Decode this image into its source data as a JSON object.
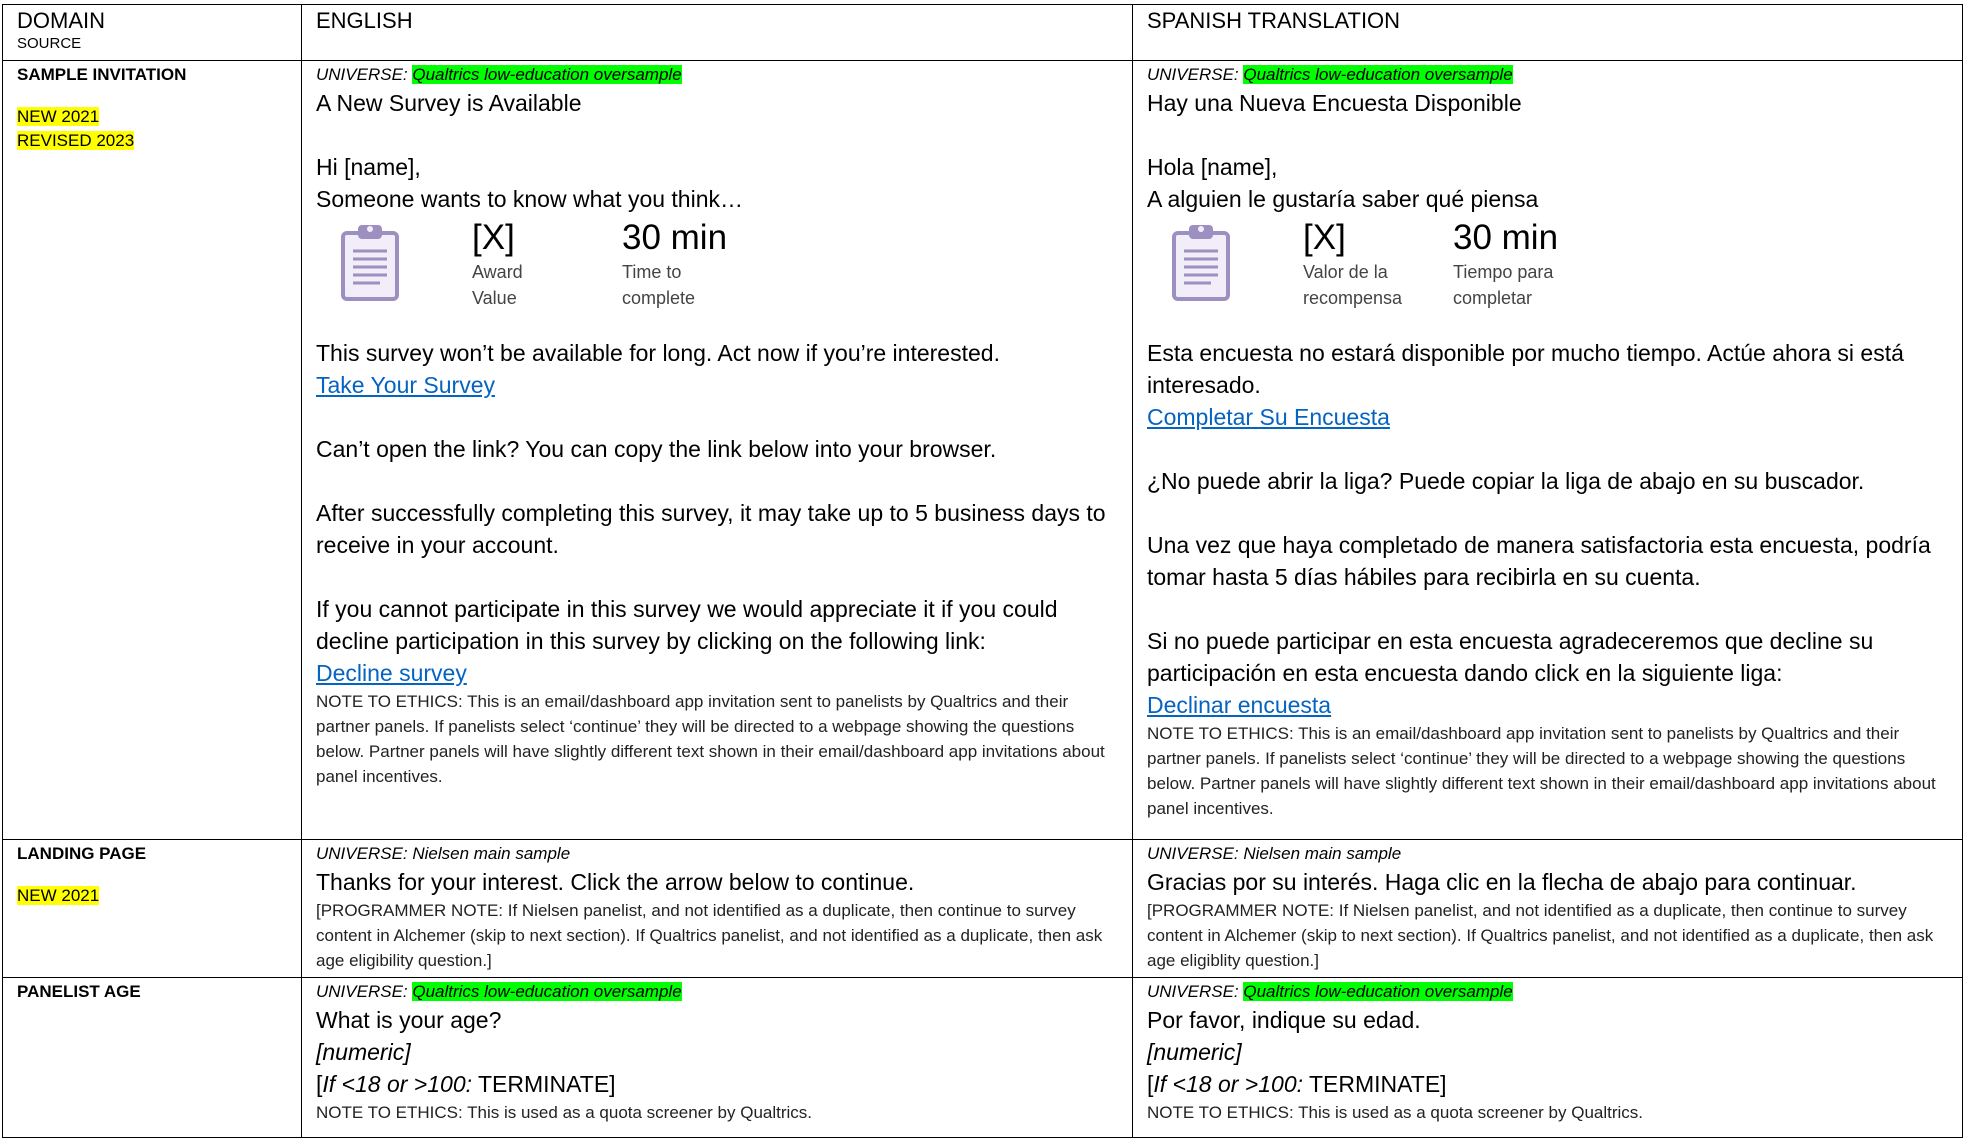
{
  "header": {
    "domain": "DOMAIN",
    "source": "SOURCE",
    "english": "ENGLISH",
    "spanish": "SPANISH TRANSLATION"
  },
  "rows": [
    {
      "domain": "SAMPLE INVITATION",
      "tags": [
        "NEW 2021",
        "REVISED 2023"
      ],
      "en": {
        "universe_prefix": "UNIVERSE: ",
        "universe": "Qualtrics low-education oversample",
        "title": "A New Survey is Available",
        "greeting": "Hi [name],",
        "intro": "Someone wants to know what you think…",
        "award_value": "[X]",
        "award_label_1": "Award",
        "award_label_2": "Value",
        "time_value": "30 min",
        "time_label_1": "Time to",
        "time_label_2": "complete",
        "availability": "This survey won’t be available for long. Act now if you’re interested.",
        "take_link": "Take Your Survey",
        "cant_open": "Can’t open the link? You can copy the link below into your browser.",
        "after": "After successfully completing this survey, it may take up to 5 business days to receive in your account.",
        "decline_text": "If you cannot participate in this survey we would appreciate it if you could decline participation in this survey by clicking on the following link:",
        "decline_link": "Decline survey",
        "note": "NOTE TO ETHICS: This is an email/dashboard app invitation sent to panelists by Qualtrics and their partner panels. If panelists select ‘continue’ they will be directed to a webpage showing the questions below. Partner panels will have slightly different text shown in their email/dashboard app invitations about panel incentives."
      },
      "es": {
        "universe_prefix": "UNIVERSE: ",
        "universe": "Qualtrics low-education oversample",
        "title": "Hay una Nueva Encuesta Disponible",
        "greeting": "Hola [name],",
        "intro": "A alguien le gustaría saber qué piensa",
        "award_value": "[X]",
        "award_label_1": "Valor de la",
        "award_label_2": "recompensa",
        "time_value": "30 min",
        "time_label_1": "Tiempo para",
        "time_label_2": "completar",
        "availability": "Esta encuesta no estará disponible por mucho tiempo. Actúe ahora si está interesado.",
        "take_link": "Completar Su Encuesta",
        "cant_open": "¿No puede abrir la liga? Puede copiar la liga de abajo en su buscador.",
        "after": "Una vez que haya completado de manera satisfactoria esta encuesta, podría tomar hasta 5 días hábiles para recibirla en su cuenta.",
        "decline_text": "Si no puede participar en esta encuesta agradeceremos que decline su participación en esta encuesta dando click en la siguiente liga:",
        "decline_link": "Declinar encuesta",
        "note": "NOTE TO ETHICS: This is an email/dashboard app invitation sent to panelists by Qualtrics and their partner panels. If panelists select ‘continue’ they will be directed to a webpage showing the questions below. Partner panels will have slightly different text shown in their email/dashboard app invitations about panel incentives."
      }
    },
    {
      "domain": "LANDING PAGE",
      "tags": [
        "NEW 2021"
      ],
      "en": {
        "universe": "UNIVERSE: Nielsen main sample",
        "title": "Thanks for your interest. Click the arrow below to continue.",
        "note": "[PROGRAMMER NOTE: If Nielsen panelist, and not identified as a duplicate, then continue to survey content in Alchemer (skip to next section). If Qualtrics panelist, and not identified as a duplicate, then ask age eligibility question.]"
      },
      "es": {
        "universe": "UNIVERSE: Nielsen main sample",
        "title": "Gracias por su interés. Haga clic en la flecha de abajo para continuar.",
        "note": "[PROGRAMMER NOTE: If Nielsen panelist, and not identified as a duplicate, then continue to survey content in Alchemer (skip to next section). If Qualtrics panelist, and not identified as a duplicate, then ask age eligiblity question.]"
      }
    },
    {
      "domain": "PANELIST AGE",
      "en": {
        "universe_prefix": "UNIVERSE: ",
        "universe": "Qualtrics low-education oversample",
        "question": "What is your age?",
        "type": "[numeric]",
        "term_open": "[",
        "term_cond": "If <18 or >100:",
        "term_action": " TERMINATE]",
        "note": "NOTE TO ETHICS: This is used as a quota screener by Qualtrics."
      },
      "es": {
        "universe_prefix": "UNIVERSE: ",
        "universe": "Qualtrics low-education oversample",
        "question": "Por favor, indique su edad.",
        "type": "[numeric]",
        "term_open": "[",
        "term_cond": "If <18 or >100:",
        "term_action": " TERMINATE]",
        "note": "NOTE TO ETHICS: This is used as a quota screener by Qualtrics."
      }
    }
  ]
}
